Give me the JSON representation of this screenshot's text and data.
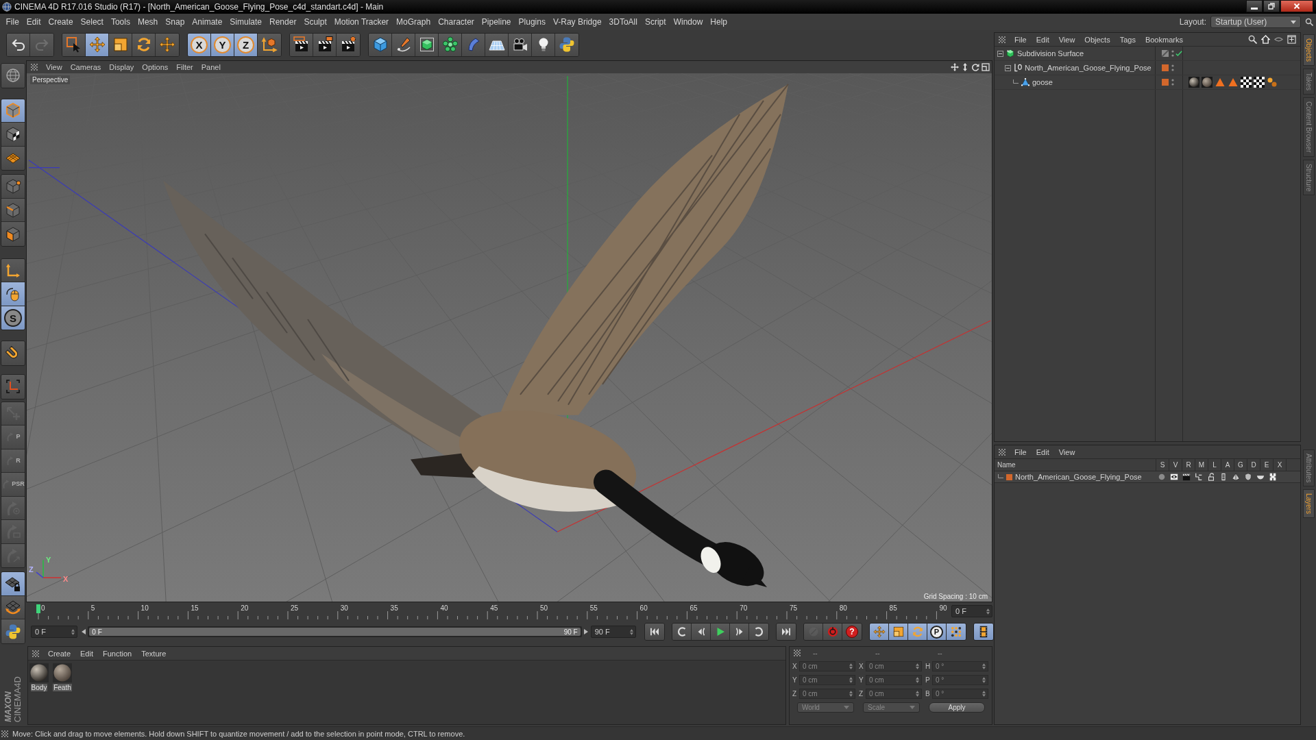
{
  "window": {
    "title": "CINEMA 4D R17.016 Studio (R17) - [North_American_Goose_Flying_Pose_c4d_standart.c4d] - Main"
  },
  "menu_bar": {
    "items": [
      "File",
      "Edit",
      "Create",
      "Select",
      "Tools",
      "Mesh",
      "Snap",
      "Animate",
      "Simulate",
      "Render",
      "Sculpt",
      "Motion Tracker",
      "MoGraph",
      "Character",
      "Pipeline",
      "Plugins",
      "V-Ray Bridge",
      "3DToAll",
      "Script",
      "Window",
      "Help"
    ],
    "layout_label": "Layout:",
    "layout_value": "Startup (User)"
  },
  "toolbar": {
    "tools": [
      {
        "selected": false,
        "disabled": false
      },
      {
        "selected": false,
        "disabled": true
      },
      {
        "selected": false,
        "disabled": false
      },
      {
        "selected": true,
        "disabled": false
      },
      {
        "selected": false,
        "disabled": false
      },
      {
        "selected": false,
        "disabled": false
      },
      {
        "selected": false,
        "disabled": false
      },
      {
        "selected": true,
        "disabled": false,
        "label": "X"
      },
      {
        "selected": true,
        "disabled": false,
        "label": "Y"
      },
      {
        "selected": true,
        "disabled": false,
        "label": "Z"
      },
      {
        "selected": false,
        "disabled": false
      },
      {
        "selected": false,
        "disabled": false
      },
      {
        "selected": false,
        "disabled": false
      },
      {
        "selected": false,
        "disabled": false
      },
      {
        "selected": false,
        "disabled": false
      },
      {
        "selected": false,
        "disabled": false
      },
      {
        "selected": false,
        "disabled": false
      },
      {
        "selected": false,
        "disabled": false
      },
      {
        "selected": false,
        "disabled": false
      },
      {
        "selected": false,
        "disabled": false
      },
      {
        "selected": false,
        "disabled": false
      },
      {
        "selected": false,
        "disabled": false
      },
      {
        "selected": false,
        "disabled": false
      }
    ]
  },
  "left_toolbar": {
    "tools": [
      {
        "selected": false,
        "disabled": false
      },
      {
        "selected": true,
        "disabled": false
      },
      {
        "selected": false,
        "disabled": false
      },
      {
        "selected": false,
        "disabled": false
      },
      {
        "selected": false,
        "disabled": false
      },
      {
        "selected": false,
        "disabled": false
      },
      {
        "selected": false,
        "disabled": false
      },
      {
        "selected": false,
        "disabled": false
      },
      {
        "selected": true,
        "disabled": false
      },
      {
        "selected": true,
        "disabled": false,
        "label": "S"
      },
      {
        "selected": false,
        "disabled": false
      },
      {
        "selected": false,
        "disabled": false
      },
      {
        "selected": false,
        "disabled": true
      },
      {
        "selected": false,
        "disabled": true,
        "label": "P"
      },
      {
        "selected": false,
        "disabled": true,
        "label": "R"
      },
      {
        "selected": false,
        "disabled": true,
        "label": "PSR"
      },
      {
        "selected": false,
        "disabled": true
      },
      {
        "selected": false,
        "disabled": true
      },
      {
        "selected": false,
        "disabled": true
      },
      {
        "selected": true,
        "disabled": false
      },
      {
        "selected": false,
        "disabled": false
      },
      {
        "selected": false,
        "disabled": false
      }
    ]
  },
  "viewport": {
    "menu": [
      "View",
      "Cameras",
      "Display",
      "Options",
      "Filter",
      "Panel"
    ],
    "camera": "Perspective",
    "axis_labels": [
      "Y",
      "Z",
      "X"
    ],
    "grid_spacing": "Grid Spacing : 10 cm"
  },
  "timeline": {
    "ticks": [
      "0",
      "5",
      "10",
      "15",
      "20",
      "25",
      "30",
      "35",
      "40",
      "45",
      "50",
      "55",
      "60",
      "65",
      "70",
      "75",
      "80",
      "85",
      "90"
    ],
    "level": 0,
    "current_frame": "0 F"
  },
  "playback": {
    "start_frame": "0 F",
    "range": {
      "start": "0 F",
      "end": "90 F",
      "level": 1
    },
    "end_frame": "90 F",
    "buttons": [
      {
        "selected": false,
        "disabled": false
      },
      {
        "selected": false,
        "disabled": false
      },
      {
        "selected": false,
        "disabled": false
      },
      {
        "selected": false,
        "disabled": false
      },
      {
        "selected": false,
        "disabled": false
      },
      {
        "selected": false,
        "disabled": false
      },
      {
        "selected": false,
        "disabled": false
      },
      {
        "selected": false,
        "disabled": true
      },
      {
        "selected": false,
        "disabled": false
      },
      {
        "selected": false,
        "disabled": false,
        "label": "?"
      },
      {
        "selected": true,
        "disabled": false
      },
      {
        "selected": true,
        "disabled": false
      },
      {
        "selected": true,
        "disabled": false
      },
      {
        "selected": true,
        "disabled": false,
        "label": "P"
      },
      {
        "selected": true,
        "disabled": false
      },
      {
        "selected": true,
        "disabled": false
      }
    ]
  },
  "material_manager": {
    "menu": [
      "Create",
      "Edit",
      "Function",
      "Texture"
    ],
    "materials": [
      {
        "name": "Body"
      },
      {
        "name": "Feath"
      }
    ]
  },
  "coordinates": {
    "headers": [
      "--",
      "--",
      "--"
    ],
    "rows": [
      {
        "axis": "X",
        "position": "0 cm",
        "size_axis": "X",
        "size": "0 cm",
        "rotation_axis": "H",
        "rotation": "0 °"
      },
      {
        "axis": "Y",
        "position": "0 cm",
        "size_axis": "Y",
        "size": "0 cm",
        "rotation_axis": "P",
        "rotation": "0 °"
      },
      {
        "axis": "Z",
        "position": "0 cm",
        "size_axis": "Z",
        "size": "0 cm",
        "rotation_axis": "B",
        "rotation": "0 °"
      }
    ],
    "mode": "World",
    "size_mode": "Scale",
    "apply": "Apply"
  },
  "object_manager": {
    "menu": [
      "File",
      "Edit",
      "View",
      "Objects",
      "Tags",
      "Bookmarks"
    ],
    "objects": [
      {
        "name": "Subdivision Surface",
        "kind": "generator",
        "enabled": true,
        "expanded": true,
        "children": [
          {
            "name": "North_American_Goose_Flying_Pose",
            "kind": "null",
            "color": "#d2672c",
            "expanded": true,
            "children": [
              {
                "name": "goose",
                "kind": "polygon",
                "color": "#d2672c",
                "tags": [
                  {
                    "kind": "material"
                  },
                  {
                    "kind": "material"
                  },
                  {
                    "kind": "selection"
                  },
                  {
                    "kind": "selection"
                  },
                  {
                    "kind": "uvw"
                  },
                  {
                    "kind": "uvw"
                  },
                  {
                    "kind": "points"
                  }
                ]
              }
            ]
          }
        ]
      }
    ]
  },
  "layer_manager": {
    "menu": [
      "File",
      "Edit",
      "View"
    ],
    "columns": [
      "Name",
      "S",
      "V",
      "R",
      "M",
      "L",
      "A",
      "G",
      "D",
      "E",
      "X"
    ],
    "layers": [
      {
        "name": "North_American_Goose_Flying_Pose",
        "color": "#d2672c"
      }
    ]
  },
  "side_tabs": {
    "top": [
      {
        "label": "Objects",
        "selected": true
      },
      {
        "label": "Takes",
        "selected": false
      },
      {
        "label": "Content Browser",
        "selected": false
      },
      {
        "label": "Structure",
        "selected": false
      }
    ],
    "bottom": [
      {
        "label": "Attributes",
        "selected": false
      },
      {
        "label": "Layers",
        "selected": true
      }
    ]
  },
  "logo": {
    "brand": "MAXON",
    "product": "CINEMA4D"
  },
  "status_bar": {
    "text": "Move: Click and drag to move elements. Hold down SHIFT to quantize movement / add to the selection in point mode, CTRL to remove."
  }
}
